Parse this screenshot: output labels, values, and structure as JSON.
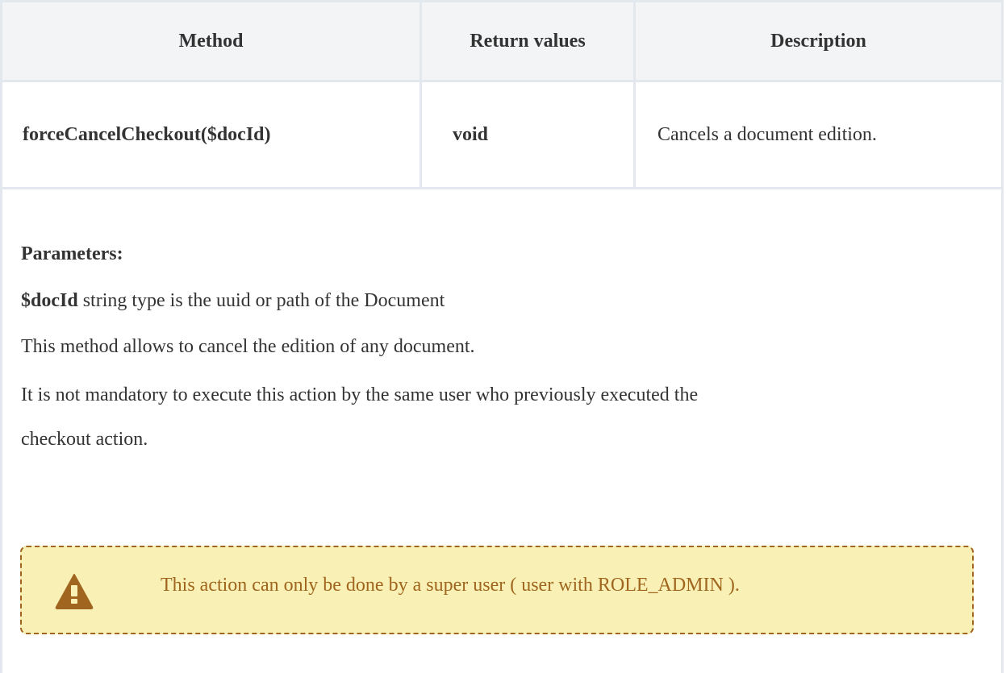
{
  "table": {
    "headers": [
      "Method",
      "Return values",
      "Description"
    ],
    "method": "forceCancelCheckout($docId)",
    "return_value": "void",
    "description": "Cancels a document edition."
  },
  "details": {
    "parameters_label": "Parameters:",
    "param_name": "$docId",
    "param_desc": "string type is the uuid or path of the Document",
    "paragraph1": "This method allows to cancel the edition of any document.",
    "paragraph2_line1": "It is not mandatory to execute this action by the same user who previously executed the",
    "paragraph2_line2": "checkout action."
  },
  "warning": {
    "icon": "warning-triangle-icon",
    "text": "This action can only be done by a super user ( user with ROLE_ADMIN ).",
    "text_color": "#a0651e",
    "background": "#f8f0b4"
  }
}
